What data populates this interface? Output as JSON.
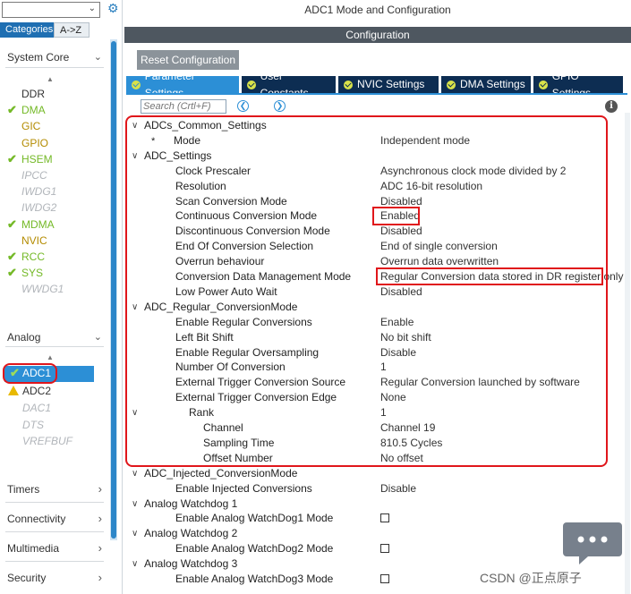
{
  "left_panel": {
    "tabs": {
      "categories": "Categories",
      "atoz": "A->Z"
    },
    "groups": {
      "system_core": "System Core",
      "analog": "Analog",
      "timers": "Timers",
      "connectivity": "Connectivity",
      "multimedia": "Multimedia",
      "security": "Security"
    },
    "system_core_items": [
      {
        "label": "DDR",
        "state": "plain"
      },
      {
        "label": "DMA",
        "state": "green"
      },
      {
        "label": "GIC",
        "state": "yellow"
      },
      {
        "label": "GPIO",
        "state": "yellow"
      },
      {
        "label": "HSEM",
        "state": "green"
      },
      {
        "label": "IPCC",
        "state": "gray"
      },
      {
        "label": "IWDG1",
        "state": "gray"
      },
      {
        "label": "IWDG2",
        "state": "gray"
      },
      {
        "label": "MDMA",
        "state": "green"
      },
      {
        "label": "NVIC",
        "state": "yellow"
      },
      {
        "label": "RCC",
        "state": "green"
      },
      {
        "label": "SYS",
        "state": "green"
      },
      {
        "label": "WWDG1",
        "state": "gray"
      }
    ],
    "analog_items": {
      "adc1": "ADC1",
      "adc2": "ADC2",
      "rest": [
        "DAC1",
        "DTS",
        "VREFBUF"
      ]
    }
  },
  "header": {
    "title": "ADC1 Mode and Configuration",
    "configuration": "Configuration",
    "reset_button": "Reset Configuration"
  },
  "tabs": [
    {
      "label": "Parameter Settings",
      "active": true
    },
    {
      "label": "User Constants",
      "active": false
    },
    {
      "label": "NVIC Settings",
      "active": false
    },
    {
      "label": "DMA Settings",
      "active": false
    },
    {
      "label": "GPIO Settings",
      "active": false
    }
  ],
  "search": {
    "placeholder": "Search (Crtl+F)"
  },
  "params": [
    {
      "kind": "group",
      "name": "ADCs_Common_Settings",
      "value": ""
    },
    {
      "kind": "param",
      "name": "Mode",
      "value": "Independent mode",
      "star": true
    },
    {
      "kind": "group",
      "name": "ADC_Settings",
      "value": ""
    },
    {
      "kind": "param",
      "name": "Clock Prescaler",
      "value": "Asynchronous clock mode divided by 2"
    },
    {
      "kind": "param",
      "name": "Resolution",
      "value": "ADC 16-bit resolution"
    },
    {
      "kind": "param",
      "name": "Scan Conversion Mode",
      "value": "Disabled"
    },
    {
      "kind": "param",
      "name": "Continuous Conversion Mode",
      "value": "Enabled"
    },
    {
      "kind": "param",
      "name": "Discontinuous Conversion Mode",
      "value": "Disabled"
    },
    {
      "kind": "param",
      "name": "End Of Conversion Selection",
      "value": "End of single conversion"
    },
    {
      "kind": "param",
      "name": "Overrun behaviour",
      "value": "Overrun data overwritten"
    },
    {
      "kind": "param",
      "name": "Conversion Data Management Mode",
      "value": "Regular Conversion data stored in DR register only"
    },
    {
      "kind": "param",
      "name": "Low Power Auto Wait",
      "value": "Disabled"
    },
    {
      "kind": "group",
      "name": "ADC_Regular_ConversionMode",
      "value": ""
    },
    {
      "kind": "param",
      "name": "Enable Regular Conversions",
      "value": "Enable"
    },
    {
      "kind": "param",
      "name": "Left Bit Shift",
      "value": "No bit shift"
    },
    {
      "kind": "param",
      "name": "Enable Regular Oversampling",
      "value": "Disable"
    },
    {
      "kind": "param",
      "name": "Number Of Conversion",
      "value": "1"
    },
    {
      "kind": "param",
      "name": "External Trigger Conversion Source",
      "value": "Regular Conversion launched by software"
    },
    {
      "kind": "param",
      "name": "External Trigger Conversion Edge",
      "value": "None"
    },
    {
      "kind": "subgroup",
      "name": "Rank",
      "value": "1"
    },
    {
      "kind": "subparam",
      "name": "Channel",
      "value": "Channel 19"
    },
    {
      "kind": "subparam",
      "name": "Sampling Time",
      "value": "810.5 Cycles"
    },
    {
      "kind": "subparam",
      "name": "Offset Number",
      "value": "No offset"
    },
    {
      "kind": "group",
      "name": "ADC_Injected_ConversionMode",
      "value": ""
    },
    {
      "kind": "param",
      "name": "Enable Injected Conversions",
      "value": "Disable"
    },
    {
      "kind": "group",
      "name": "Analog Watchdog 1",
      "value": ""
    },
    {
      "kind": "param",
      "name": "Enable Analog WatchDog1 Mode",
      "value": "",
      "checkbox": true
    },
    {
      "kind": "group",
      "name": "Analog Watchdog 2",
      "value": ""
    },
    {
      "kind": "param",
      "name": "Enable Analog WatchDog2 Mode",
      "value": "",
      "checkbox": true
    },
    {
      "kind": "group",
      "name": "Analog Watchdog 3",
      "value": ""
    },
    {
      "kind": "param",
      "name": "Enable Analog WatchDog3 Mode",
      "value": "",
      "checkbox": true
    }
  ],
  "watermark": {
    "text": "CSDN @正点原子"
  },
  "colors": {
    "accent": "#2c8fd6",
    "highlight": "#e0161b",
    "tab_dark": "#0d2d52",
    "ok_green": "#74b927",
    "warn_yellow": "#e8b900"
  }
}
